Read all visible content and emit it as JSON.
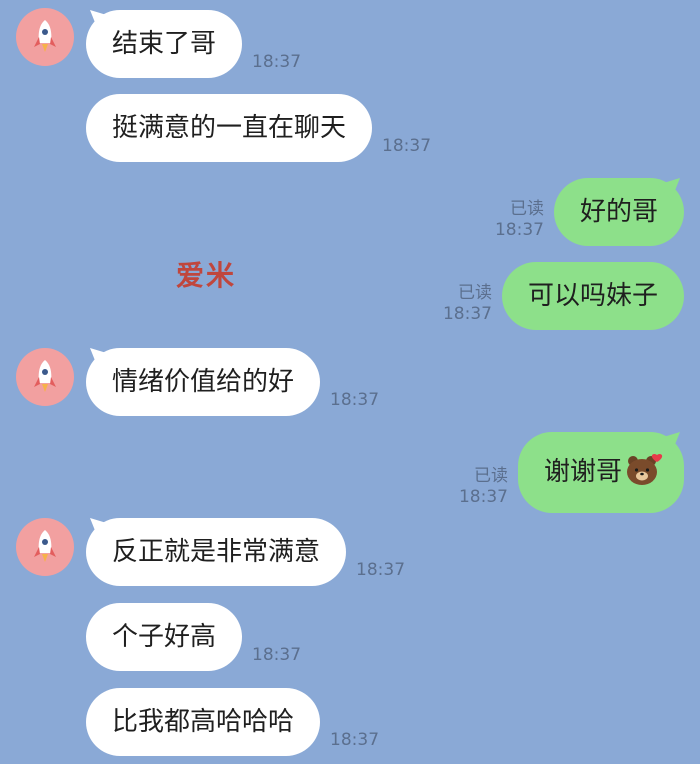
{
  "contact": {
    "avatar_icon": "rocket-icon"
  },
  "watermark": "爱米",
  "messages": [
    {
      "id": "m1",
      "side": "in",
      "text": "结束了哥",
      "time": "18:37"
    },
    {
      "id": "m2",
      "side": "in",
      "text": "挺满意的一直在聊天",
      "time": "18:37"
    },
    {
      "id": "m3",
      "side": "out",
      "text": "好的哥",
      "read": "已读",
      "time": "18:37"
    },
    {
      "id": "m4",
      "side": "out",
      "text": "可以吗妹子",
      "read": "已读",
      "time": "18:37"
    },
    {
      "id": "m5",
      "side": "in",
      "text": "情绪价值给的好",
      "time": "18:37"
    },
    {
      "id": "m6",
      "side": "out",
      "text": "谢谢哥",
      "emoji": "bear-heart-emoji",
      "read": "已读",
      "time": "18:37"
    },
    {
      "id": "m7",
      "side": "in",
      "text": "反正就是非常满意",
      "time": "18:37"
    },
    {
      "id": "m8",
      "side": "in",
      "text": "个子好高",
      "time": "18:37"
    },
    {
      "id": "m9",
      "side": "in",
      "text": "比我都高哈哈哈",
      "time": "18:37"
    }
  ],
  "colors": {
    "background": "#8aa9d6",
    "incoming_bubble": "#ffffff",
    "outgoing_bubble": "#8de08a",
    "avatar": "#f2a0a0",
    "watermark": "#c0463d"
  }
}
